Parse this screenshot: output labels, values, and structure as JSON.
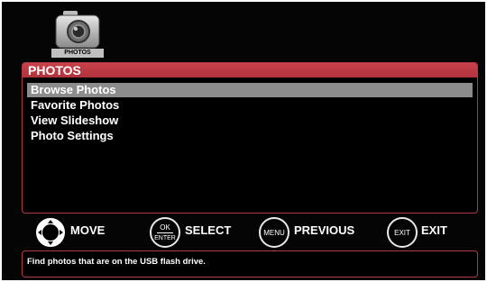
{
  "app_icon": {
    "caption": "PHOTOS",
    "icon": "camera-icon"
  },
  "menu": {
    "title": "PHOTOS",
    "items": [
      {
        "label": "Browse Photos",
        "selected": true
      },
      {
        "label": "Favorite Photos",
        "selected": false
      },
      {
        "label": "View Slideshow",
        "selected": false
      },
      {
        "label": "Photo Settings",
        "selected": false
      }
    ]
  },
  "controls": {
    "move": {
      "label": "MOVE",
      "icon": "dpad-icon"
    },
    "select": {
      "label": "SELECT",
      "key_top": "OK",
      "key_bottom": "ENTER"
    },
    "previous": {
      "label": "PREVIOUS",
      "key": "MENU"
    },
    "exit": {
      "label": "EXIT",
      "key": "EXIT"
    }
  },
  "status": {
    "text": "Find photos that are on the USB flash drive."
  },
  "colors": {
    "accent": "#c0404a",
    "selected_bg": "#8c8c8c",
    "background": "#050505"
  }
}
